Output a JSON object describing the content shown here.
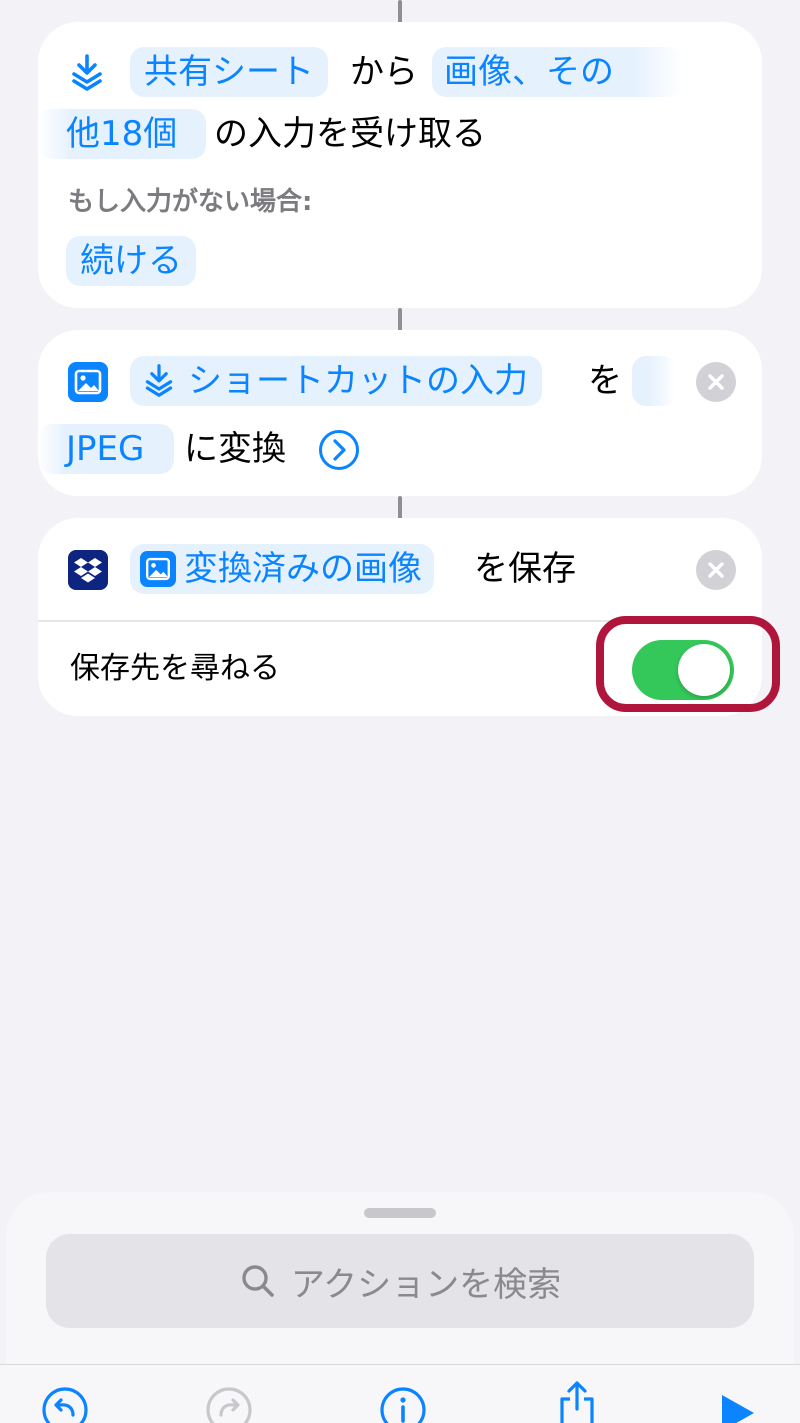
{
  "colors": {
    "accent": "#0a84ff",
    "chip_bg": "#e6f1fe",
    "toggle_on": "#34c759",
    "highlight": "#b0163c",
    "background": "#f2f2f7",
    "dropbox": "#0d2481"
  },
  "action1": {
    "icon": "shortcut-input-icon",
    "source_chip": "共有シート",
    "text_from": "から",
    "types_chip_part1": "画像、その",
    "types_chip_part2": "他18個",
    "text_receive": "の入力を受け取る",
    "no_input_label": "もし入力がない場合:",
    "no_input_chip": "続ける"
  },
  "action2": {
    "icon": "photo-icon",
    "input_chip": "ショートカットの入力",
    "text_wo": "を",
    "format_chip": "JPEG",
    "text_convert": "に変換",
    "expand_icon": "chevron-circle-right-icon",
    "close_icon": "close-icon"
  },
  "action3": {
    "icon": "dropbox-icon",
    "variable_chip": "変換済みの画像",
    "text_save": "を保存",
    "close_icon": "close-icon",
    "option_label": "保存先を尋ねる",
    "toggle_on": true
  },
  "sheet": {
    "search_placeholder": "アクションを検索"
  },
  "toolbar": {
    "icons": [
      "undo-icon",
      "redo-icon",
      "info-icon",
      "share-icon",
      "play-icon"
    ]
  }
}
